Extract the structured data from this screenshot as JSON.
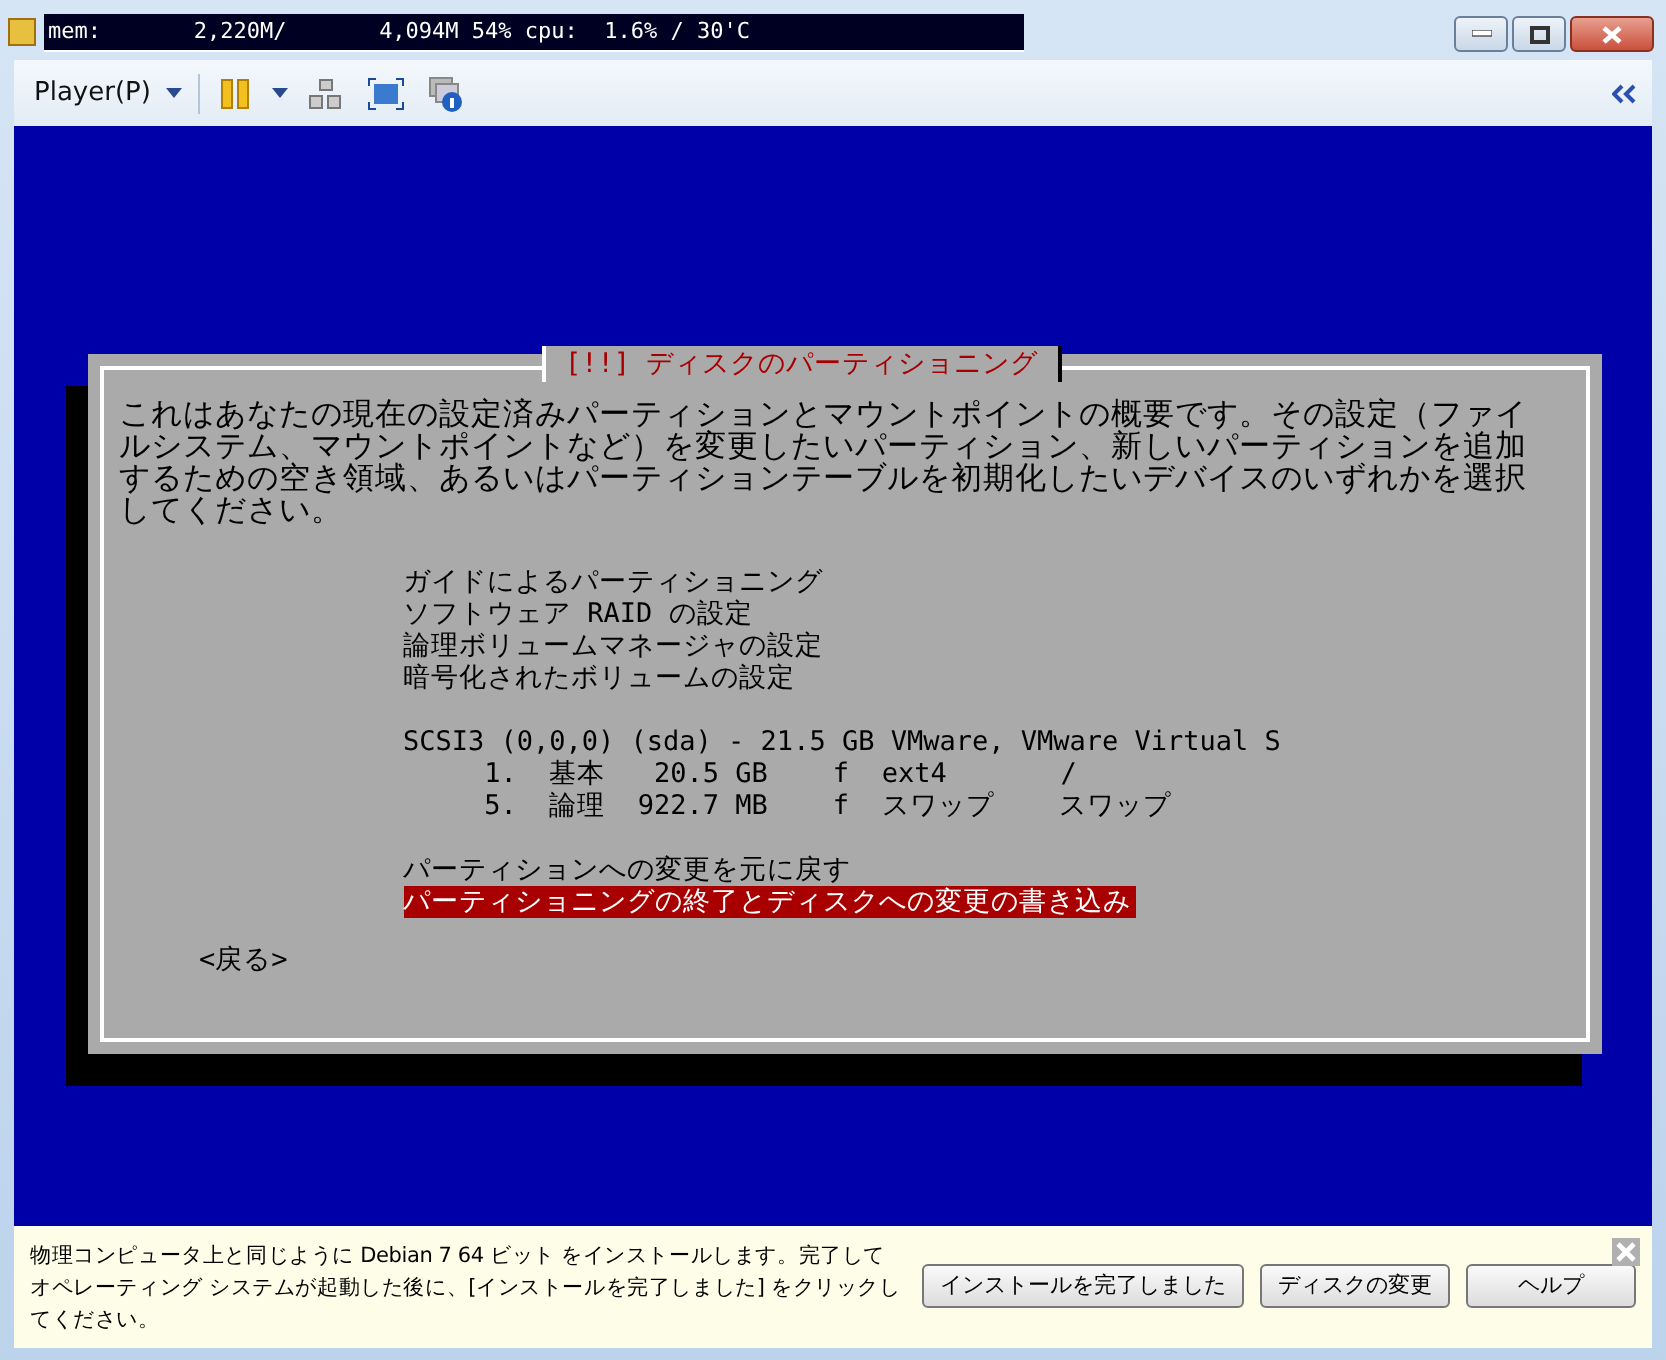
{
  "titlebar": {
    "status_text": "mem:       2,220M/       4,094M 54% cpu:  1.6% / 30'C"
  },
  "toolbar": {
    "player_menu": "Player(P)"
  },
  "dialog": {
    "title": "[!!] ディスクのパーティショニング",
    "description": "これはあなたの現在の設定済みパーティションとマウントポイントの概要です。その設定（ファイルシステム、マウントポイントなど）を変更したいパーティション、新しいパーティションを追加するための空き領域、あるいはパーティションテーブルを初期化したいデバイスのいずれかを選択してください。",
    "items": [
      {
        "kind": "option",
        "text": "ガイドによるパーティショニング",
        "selected": false
      },
      {
        "kind": "option",
        "text": "ソフトウェア RAID の設定",
        "selected": false
      },
      {
        "kind": "option",
        "text": "論理ボリュームマネージャの設定",
        "selected": false
      },
      {
        "kind": "option",
        "text": "暗号化されたボリュームの設定",
        "selected": false
      },
      {
        "kind": "spacer"
      },
      {
        "kind": "option",
        "text": "SCSI3 (0,0,0) (sda) - 21.5 GB VMware, VMware Virtual S",
        "selected": false
      },
      {
        "kind": "option",
        "text": "     1.  基本   20.5 GB    f  ext4       /",
        "selected": false
      },
      {
        "kind": "option",
        "text": "     5.  論理  922.7 MB    f  スワップ    スワップ",
        "selected": false
      },
      {
        "kind": "spacer"
      },
      {
        "kind": "option",
        "text": "パーティションへの変更を元に戻す",
        "selected": false
      },
      {
        "kind": "option",
        "text": "パーティショニングの終了とディスクへの変更の書き込み",
        "selected": true
      }
    ],
    "back_button": "<戻る>"
  },
  "install_bar": {
    "message": "物理コンピュータ上と同じように Debian 7 64 ビット をインストールします。完了してオペレーティング システムが起動した後に、[インストールを完了しました] をクリックしてください。",
    "buttons": [
      "インストールを完了しました",
      "ディスクの変更",
      "ヘルプ"
    ]
  }
}
